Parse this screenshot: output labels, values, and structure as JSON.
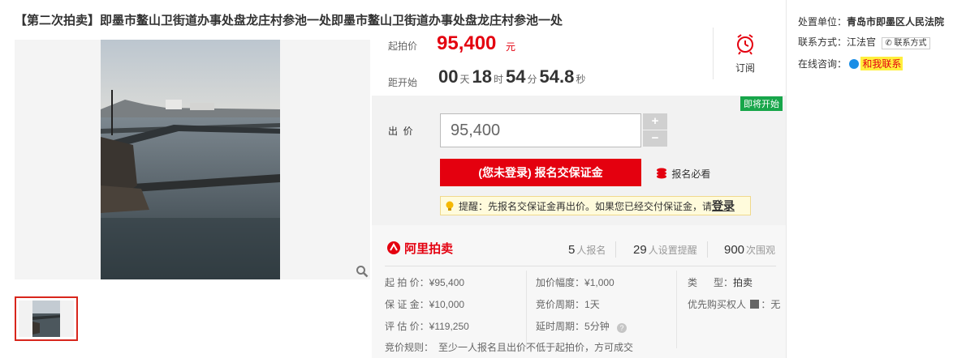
{
  "title": "【第二次拍卖】即墨市鳌山卫街道办事处盘龙庄村参池一处即墨市鳌山卫街道办事处盘龙庄村参池一处",
  "price": {
    "label": "起拍价",
    "value": "95,400",
    "unit": "元"
  },
  "countdown": {
    "label": "距开始",
    "days": "00",
    "days_unit": "天",
    "hours": "18",
    "hours_unit": "时",
    "minutes": "54",
    "minutes_unit": "分",
    "seconds": "54.8",
    "seconds_unit": "秒"
  },
  "subscribe": {
    "label": "订阅",
    "icon": "alarm-clock-icon"
  },
  "bid": {
    "badge": "即将开始",
    "label": "出  价",
    "input_value": "95,400",
    "plus": "+",
    "minus": "−",
    "register_button": "(您未登录) 报名交保证金",
    "must_read": "报名必看",
    "tip_text": "提醒：先报名交保证金再出价。如果您已经交付保证金，请",
    "tip_login": "登录"
  },
  "stats": {
    "logo": "阿里拍卖",
    "registrations_num": "5",
    "registrations_label": "人报名",
    "reminders_num": "29",
    "reminders_label": "人设置提醒",
    "views_num": "900",
    "views_label": "次围观"
  },
  "details": {
    "start_price_label": "起 拍 价：",
    "start_price_value": "¥95,400",
    "deposit_label": "保 证 金：",
    "deposit_value": "¥10,000",
    "appraisal_label": "评 估 价：",
    "appraisal_value": "¥119,250",
    "increment_label": "加价幅度：",
    "increment_value": "¥1,000",
    "cycle_label": "竞价周期：",
    "cycle_value": "1天",
    "delay_label": "延时周期：",
    "delay_value": "5分钟",
    "type_label": "类      型：",
    "type_value": "拍卖",
    "priority_label": "优先购买权人",
    "priority_value": "无",
    "rule_label": "竞价规则：",
    "rule_value": "至少一人报名且出价不低于起拍价，方可成交"
  },
  "sidebar": {
    "unit_label": "处置单位：",
    "unit_value": "青岛市即墨区人民法院",
    "contact_label": "联系方式：",
    "contact_value": "江法官",
    "contact_button": "联系方式",
    "chat_label": "在线咨询：",
    "chat_link": "和我联系"
  },
  "colors": {
    "accent_red": "#e4000f",
    "badge_green": "#17a64a",
    "tip_bg": "#fffbdc"
  }
}
